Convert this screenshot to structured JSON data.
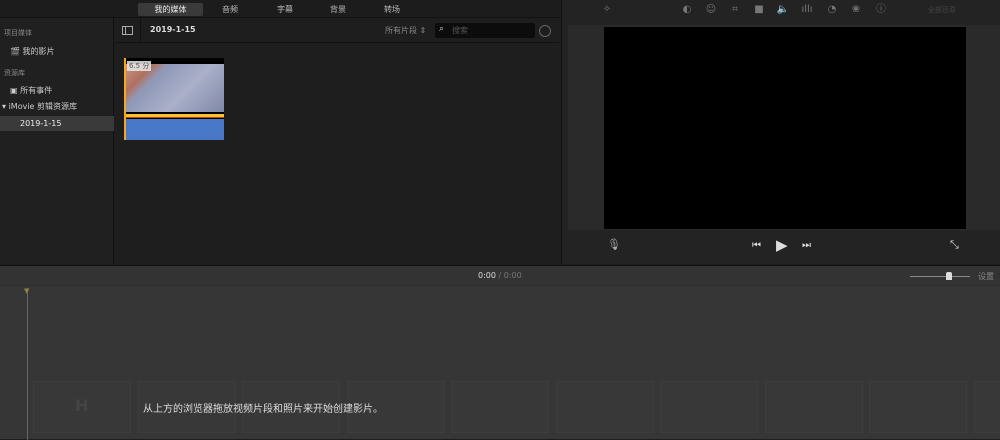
{
  "tabs": [
    {
      "label": "我的媒体",
      "active": true
    },
    {
      "label": "音频"
    },
    {
      "label": "字幕"
    },
    {
      "label": "背景"
    },
    {
      "label": "转场"
    }
  ],
  "sidebar": {
    "project_header": "项目媒体",
    "my_movie": "我的影片",
    "library_header": "资源库",
    "all_events": "所有事件",
    "library_name": "iMovie 剪辑资源库",
    "event": "2019-1-15"
  },
  "browser": {
    "title": "2019-1-15",
    "filter": "所有片段",
    "search_placeholder": "搜索",
    "clip": {
      "duration": "6.5 分"
    }
  },
  "viewer": {
    "reset_all": "全部还原",
    "tools": [
      "magic-wand",
      "color-balance",
      "color-correction",
      "crop",
      "stabilization",
      "volume",
      "noise-reduction",
      "speed",
      "clip-filter",
      "info"
    ]
  },
  "timeline": {
    "current_time": "0:00",
    "separator": "/",
    "total_time": "0:00",
    "settings": "设置",
    "zoom_level": 0.65,
    "hint": "从上方的浏览器拖放视频片段和照片来开始创建影片。"
  },
  "colors": {
    "accent": "#f5a623",
    "clip_blue": "#4a78c8",
    "clip_yellow": "#f2c230"
  }
}
